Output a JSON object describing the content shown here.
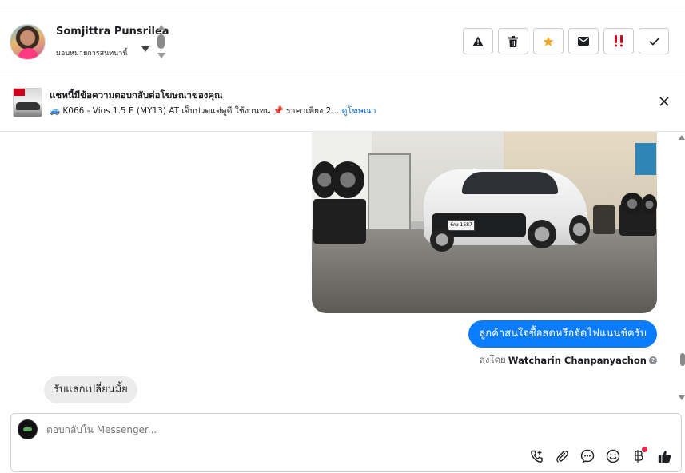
{
  "header": {
    "contact_name": "Somjittra Punsrilea",
    "assign_label": "มอบหมายการสนทนานี้",
    "actions": [
      {
        "name": "report-icon"
      },
      {
        "name": "trash-icon"
      },
      {
        "name": "star-icon",
        "color": "#f5a623"
      },
      {
        "name": "mail-icon"
      },
      {
        "name": "priority-icon",
        "color": "#d0021b"
      },
      {
        "name": "check-icon"
      }
    ]
  },
  "ad_banner": {
    "title": "แชทนี้มีข้อความตอบกลับต่อโฆษณาของคุณ",
    "subtitle": "🚙 K066 - Vios 1.5 E (MY13) AT เจ็บปวดแต่ดูดี ใช้งานทน 📌 ราคาเพียง 2...",
    "link_label": "ดูโฆษณา"
  },
  "messages": [
    {
      "type": "image",
      "plate_text": "6กง 1587"
    },
    {
      "type": "outgoing",
      "text": "ลูกค้าสนใจซื้อสดหรือจัดไฟแนนช์ครับ"
    },
    {
      "type": "sent_by",
      "prefix": "ส่งโดย",
      "name": "Watcharin Chanpanyachon"
    },
    {
      "type": "incoming",
      "text": "รับแลกเปลี่ยนมั้ย"
    }
  ],
  "composer": {
    "placeholder": "ตอบกลับใน Messenger...",
    "tools": [
      "call-add-icon",
      "attach-icon",
      "chat-bubble-icon",
      "emoji-icon",
      "baht-icon",
      "thumbs-up-icon"
    ]
  },
  "colors": {
    "accent": "#0a7cff",
    "link": "#0866c6",
    "notification": "#f02849"
  }
}
